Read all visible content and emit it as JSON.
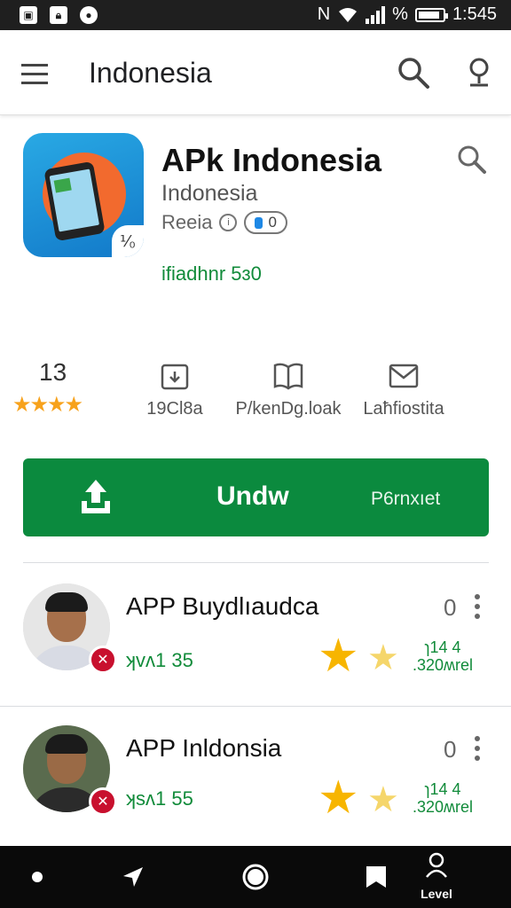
{
  "status_bar": {
    "left_icons": [
      "image-icon",
      "lock-icon",
      "alarm-icon"
    ],
    "network_label": "N",
    "battery_label": "%",
    "battery_level": 0.9,
    "time": "1:545"
  },
  "app_bar": {
    "title": "Indonesia"
  },
  "app": {
    "name": "APk Indonesia",
    "developer": "Indonesia",
    "content_label": "Reeia",
    "pill_value": "0",
    "icon_badge": "⅟₀",
    "green_text": "ifiadhnr 5ɜ0"
  },
  "stats": {
    "rating_value": "13",
    "stars": "★★★★",
    "downloads_label": "19Cl8a",
    "category_label": "P/kenDg.loak",
    "contact_label": "Laħfiostita"
  },
  "install": {
    "label": "Undw",
    "secondary_label": "P6rnxıet"
  },
  "reviews": [
    {
      "title": "APP Buydlıaudca",
      "count": "0",
      "meta": "ʞvʌ1 35",
      "side_top": "ɿ14 4",
      "side_bottom": ".320ʍrel",
      "badge": "✕"
    },
    {
      "title": "APP Inldonsia",
      "count": "0",
      "meta": "ʞsʌ1 55",
      "side_top": "ɿ14 4",
      "side_bottom": ".320ʍrel",
      "badge": "✕"
    }
  ],
  "nav_bar": {
    "profile_label": "Level"
  },
  "colors": {
    "install_green": "#0b8a3e",
    "accent_green_text": "#118b3a",
    "star_orange": "#f7a21c",
    "status_bar": "#1f1f1f",
    "nav_bar": "#0a0a0a"
  }
}
